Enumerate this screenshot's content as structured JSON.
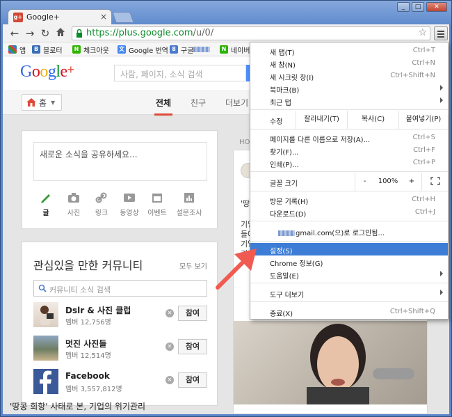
{
  "browser": {
    "tab_title": "Google+",
    "tab_close": "×",
    "url_secure": "https://plus.google.com",
    "url_path": "/u/0/",
    "win_min": "_",
    "win_max": "□",
    "win_close": "✕"
  },
  "bookmarks": [
    {
      "label": "앱",
      "icon": "apps-icon",
      "color": "#e0a020"
    },
    {
      "label": "블로터",
      "icon": "B",
      "color": "#3a6fb5"
    },
    {
      "label": "체크아웃",
      "icon": "N",
      "color": "#2db400"
    },
    {
      "label": "Google 번역",
      "icon": "文",
      "color": "#4285f4"
    },
    {
      "label": "구글",
      "icon": "8",
      "color": "#4a7bd0"
    },
    {
      "label": "네이버",
      "icon": "N",
      "color": "#2db400"
    }
  ],
  "gplus": {
    "search_placeholder": "사람, 페이지, 소식 검색",
    "home_label": "홈",
    "tabs": [
      "전체",
      "친구",
      "더보기"
    ],
    "share_placeholder": "새로운 소식을 공유하세요...",
    "share_actions": [
      "글",
      "사진",
      "링크",
      "동영상",
      "이벤트",
      "설문조사"
    ],
    "communities_title": "관심있을 만한 커뮤니티",
    "communities_more": "모두 보기",
    "communities_search": "커뮤니티 소식 검색",
    "join_label": "참여",
    "communities": [
      {
        "name": "Dslr & 사진 클럽",
        "members": "멤버 12,756명"
      },
      {
        "name": "멋진 사진들",
        "members": "멤버 12,514명"
      },
      {
        "name": "Facebook",
        "members": "멤버 3,557,812명"
      }
    ],
    "hot_label": "HOT",
    "right_snips": [
      "'땅",
      "기업",
      "들에",
      "기업",
      "기"
    ],
    "right_caption": "'땅콩 회항' 사태로 본, 기업의 위기관리"
  },
  "menu": {
    "items_top": [
      {
        "label": "새 탭(T)",
        "shortcut": "Ctrl+T"
      },
      {
        "label": "새 창(N)",
        "shortcut": "Ctrl+N"
      },
      {
        "label": "새 시크릿 창(I)",
        "shortcut": "Ctrl+Shift+N"
      },
      {
        "label": "북마크(B)",
        "shortcut": ""
      },
      {
        "label": "최근 탭",
        "shortcut": ""
      }
    ],
    "edit": {
      "label": "수정",
      "cut": "잘라내기(T)",
      "copy": "복사(C)",
      "paste": "붙여넣기(P)"
    },
    "items_mid": [
      {
        "label": "페이지를 다른 이름으로 저장(A)...",
        "shortcut": "Ctrl+S"
      },
      {
        "label": "찾기(F)...",
        "shortcut": "Ctrl+F"
      },
      {
        "label": "인쇄(P)...",
        "shortcut": "Ctrl+P"
      }
    ],
    "zoom": {
      "label": "글꼴 크기",
      "minus": "-",
      "value": "100%",
      "plus": "+"
    },
    "items_dl": [
      {
        "label": "방문 기록(H)",
        "shortcut": "Ctrl+H"
      },
      {
        "label": "다운로드(D)",
        "shortcut": "Ctrl+J"
      }
    ],
    "signin": "gmail.com(으)로 로그인됨...",
    "items_settings": [
      {
        "label": "설정(S)",
        "shortcut": ""
      },
      {
        "label": "Chrome 정보(G)",
        "shortcut": ""
      },
      {
        "label": "도움말(E)",
        "shortcut": ""
      }
    ],
    "more_tools": "도구 더보기",
    "exit": {
      "label": "종료(X)",
      "shortcut": "Ctrl+Shift+Q"
    }
  },
  "colors": {
    "highlight": "#3d7dd6",
    "arrow": "#f05a50",
    "brand_red": "#dd4b39"
  }
}
